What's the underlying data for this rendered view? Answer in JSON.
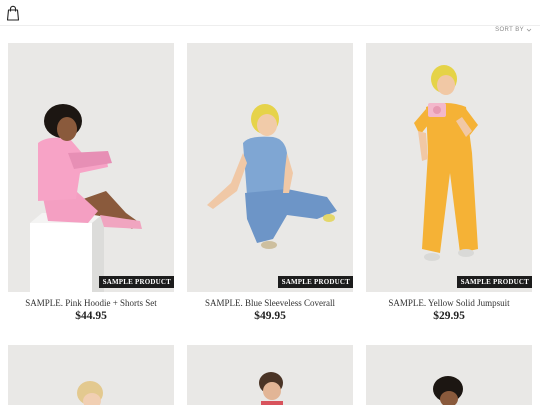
{
  "header": {
    "cart_icon": "shopping-bag-icon"
  },
  "toolbar": {
    "sort_label": "SORT BY",
    "sort_icon": "chevron-down-icon"
  },
  "products": [
    {
      "badge": "SAMPLE PRODUCT",
      "title": "SAMPLE. Pink Hoodie + Shorts Set",
      "price": "$44.95"
    },
    {
      "badge": "SAMPLE PRODUCT",
      "title": "SAMPLE. Blue Sleeveless Coverall",
      "price": "$49.95"
    },
    {
      "badge": "SAMPLE PRODUCT",
      "title": "SAMPLE. Yellow Solid Jumpsuit",
      "price": "$29.95"
    }
  ],
  "colors": {
    "photo_background": "#e9e8e6",
    "badge_background": "#1c1c1c"
  }
}
